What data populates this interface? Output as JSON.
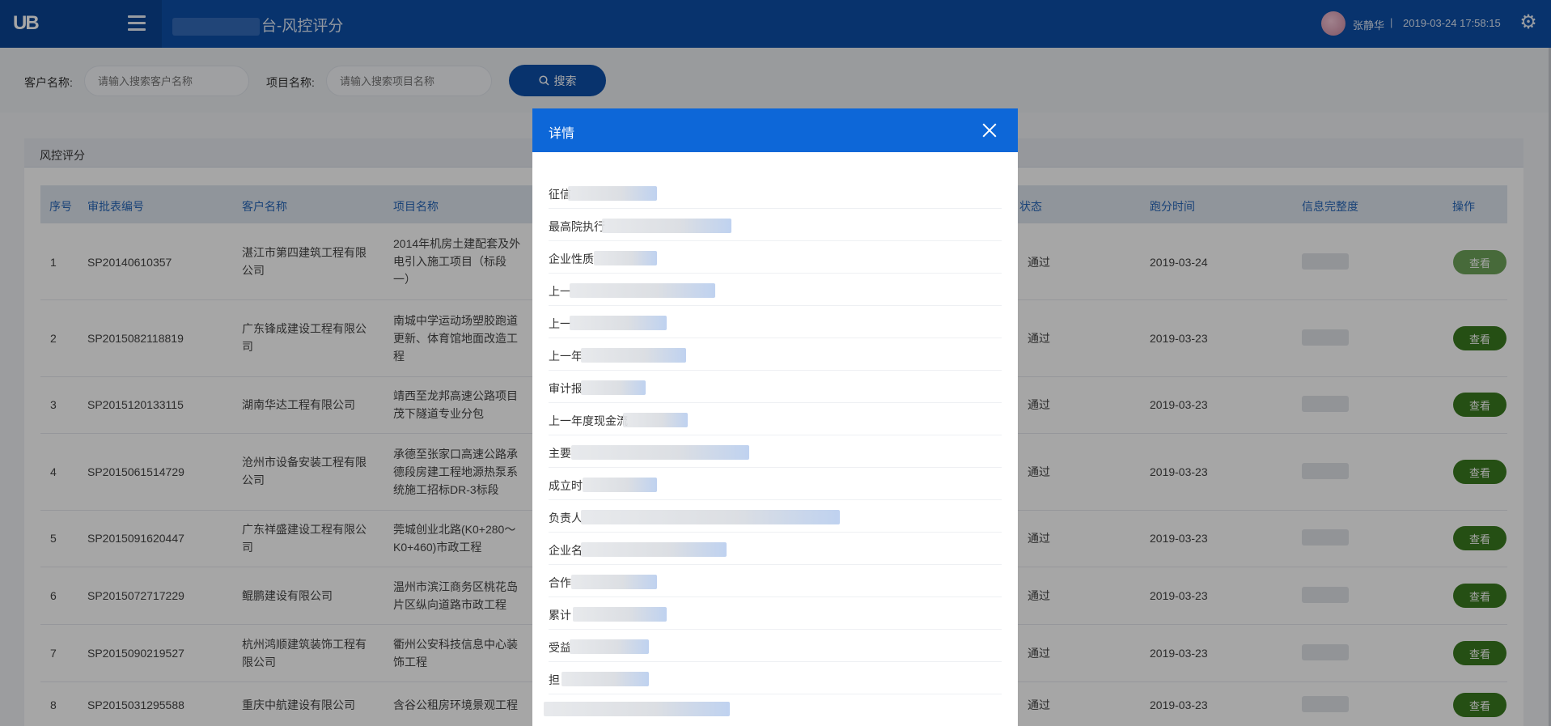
{
  "header": {
    "logo_text": "UB",
    "app_title": "台-风控评分",
    "user_name": "张静华",
    "separator": "|",
    "datetime": "2019-03-24 17:58:15"
  },
  "search": {
    "customer_label": "客户名称:",
    "customer_placeholder": "请输入搜索客户名称",
    "project_label": "项目名称:",
    "project_placeholder": "请输入搜索项目名称",
    "search_button": "搜索"
  },
  "panel": {
    "title": "风控评分",
    "columns": {
      "seq": "序号",
      "approval_no": "审批表编号",
      "customer": "客户名称",
      "project": "项目名称",
      "status": "状态",
      "score_time": "跑分时间",
      "completeness": "信息完整度",
      "action": "操作"
    },
    "rows": [
      {
        "seq": "1",
        "approval_no": "SP20140610357",
        "customer": "湛江市第四建筑工程有限公司",
        "project": "2014年机房土建配套及外电引入施工项目（标段一）",
        "status": "通过",
        "score_time": "2019-03-24",
        "action": "查看"
      },
      {
        "seq": "2",
        "approval_no": "SP2015082118819",
        "customer": "广东锋成建设工程有限公司",
        "project": "南城中学运动场塑胶跑道更新、体育馆地面改造工程",
        "status": "通过",
        "score_time": "2019-03-23",
        "action": "查看"
      },
      {
        "seq": "3",
        "approval_no": "SP2015120133115",
        "customer": "湖南华达工程有限公司",
        "project": "靖西至龙邦高速公路项目茂下隧道专业分包",
        "status": "通过",
        "score_time": "2019-03-23",
        "action": "查看"
      },
      {
        "seq": "4",
        "approval_no": "SP2015061514729",
        "customer": "沧州市设备安装工程有限公司",
        "project": "承德至张家口高速公路承德段房建工程地源热泵系统施工招标DR-3标段",
        "status": "通过",
        "score_time": "2019-03-23",
        "action": "查看"
      },
      {
        "seq": "5",
        "approval_no": "SP2015091620447",
        "customer": "广东祥盛建设工程有限公司",
        "project": "莞城创业北路(K0+280～K0+460)市政工程",
        "status": "通过",
        "score_time": "2019-03-23",
        "action": "查看"
      },
      {
        "seq": "6",
        "approval_no": "SP2015072717229",
        "customer": "鲲鹏建设有限公司",
        "project": "温州市滨江商务区桃花岛片区纵向道路市政工程",
        "status": "通过",
        "score_time": "2019-03-23",
        "action": "查看"
      },
      {
        "seq": "7",
        "approval_no": "SP2015090219527",
        "customer": "杭州鸿顺建筑装饰工程有限公司",
        "project": "衢州公安科技信息中心装饰工程",
        "status": "通过",
        "score_time": "2019-03-23",
        "action": "查看"
      },
      {
        "seq": "8",
        "approval_no": "SP2015031295588",
        "customer": "重庆中航建设有限公司",
        "project": "含谷公租房环境景观工程",
        "status": "通过",
        "score_time": "2019-03-23",
        "action": "查看"
      }
    ]
  },
  "modal": {
    "title": "详情",
    "fields": [
      {
        "label": "征信"
      },
      {
        "label": "最高院执行"
      },
      {
        "label": "企业性质"
      },
      {
        "label": "上一"
      },
      {
        "label": "上一"
      },
      {
        "label": "上一年"
      },
      {
        "label": "审计报"
      },
      {
        "label": "上一年度现金流"
      },
      {
        "label": "主要"
      },
      {
        "label": "成立时"
      },
      {
        "label": "负责人"
      },
      {
        "label": "企业名"
      },
      {
        "label": "合作"
      },
      {
        "label": "累计"
      },
      {
        "label": "受益"
      },
      {
        "label": "担"
      },
      {
        "label": ""
      }
    ]
  }
}
